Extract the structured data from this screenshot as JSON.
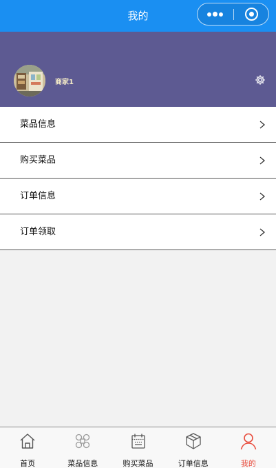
{
  "nav": {
    "title": "我的"
  },
  "profile": {
    "username": "商家1"
  },
  "menu": {
    "items": [
      {
        "label": "菜品信息"
      },
      {
        "label": "购买菜品"
      },
      {
        "label": "订单信息"
      },
      {
        "label": "订单领取"
      }
    ]
  },
  "tabbar": {
    "items": [
      {
        "label": "首页",
        "icon": "home-icon"
      },
      {
        "label": "菜品信息",
        "icon": "command-icon"
      },
      {
        "label": "购买菜品",
        "icon": "calendar-icon"
      },
      {
        "label": "订单信息",
        "icon": "box-icon"
      },
      {
        "label": "我的",
        "icon": "user-icon",
        "active": true
      }
    ],
    "active_color": "#e84c3d",
    "inactive_color": "#555555"
  },
  "colors": {
    "nav_bg": "#1a8ff2",
    "profile_bg": "#5d5a92",
    "username": "#f2e9c6"
  }
}
